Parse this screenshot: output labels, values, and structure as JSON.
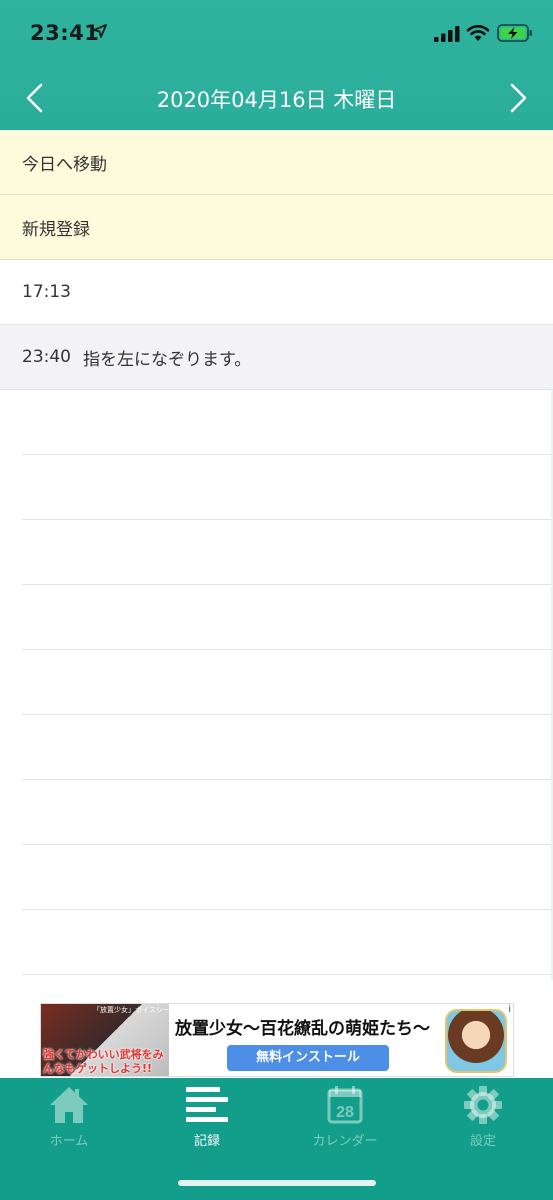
{
  "status_bar": {
    "time": "23:41"
  },
  "nav": {
    "title": "2020年04月16日 木曜日"
  },
  "actions": [
    {
      "label": "今日へ移動"
    },
    {
      "label": "新規登録"
    }
  ],
  "records": [
    {
      "time": "17:13",
      "text": ""
    },
    {
      "time": "23:40",
      "text": "指を左になぞります。"
    }
  ],
  "ad": {
    "thumb_header": "「放置少女」ボイスシーンプレイ動画",
    "thumb_caption": "強くてかわいい武将をみんなもゲットしよう!!",
    "title": "放置少女～百花繚乱の萌姫たち～",
    "install_label": "無料インストール",
    "info_mark": "i"
  },
  "tabs": [
    {
      "label": "ホーム",
      "icon": "home-icon"
    },
    {
      "label": "記録",
      "icon": "list-icon"
    },
    {
      "label": "カレンダー",
      "icon": "calendar-icon"
    },
    {
      "label": "設定",
      "icon": "gear-icon"
    }
  ],
  "calendar_icon_day": "28",
  "active_tab": "記録",
  "colors": {
    "header": "#2fb39e",
    "tab_bar": "#139e8b",
    "action_bg": "#fefadc",
    "alt_row_bg": "#f3f2f6",
    "install_button": "#4d8ee6"
  }
}
